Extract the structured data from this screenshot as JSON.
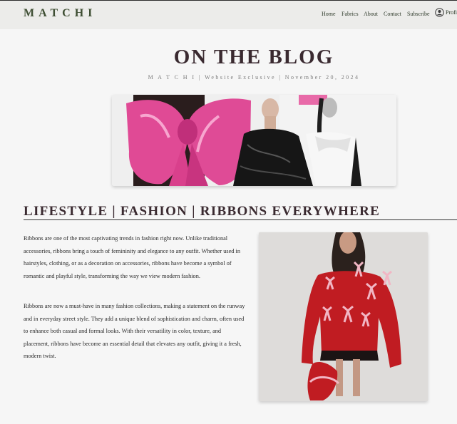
{
  "header": {
    "logo": "MATCHI",
    "nav": [
      "Home",
      "Fabrics",
      "About",
      "Contact",
      "Subscribe"
    ],
    "profile_label": "Profile"
  },
  "blog": {
    "title": "ON THE BLOG",
    "meta": "M A T C H I | Website Exclusive | November 20, 2024"
  },
  "article": {
    "heading": "LIFESTYLE | FASHION | RIBBONS EVERYWHERE",
    "paragraphs": [
      "Ribbons are one of the most captivating trends in fashion right now. Unlike traditional accessories, ribbons bring a touch of femininity and elegance to any outfit. Whether used in hairstyles, clothing, or as a decoration on accessories, ribbons have become a symbol of romantic and playful style, transforming the way we view modern fashion.",
      "Ribbons are now a must-have in many fashion collections, making a statement on the runway and in everyday street style. They add a unique blend of sophistication and charm, often used to enhance both casual and formal looks. With their versatility in color, texture, and placement, ribbons have become an essential detail that elevates any outfit, giving it a fresh, modern twist."
    ]
  },
  "colors": {
    "logo": "#3f4f34",
    "pink_bow": "#e0509a",
    "red_sweater": "#c01c22",
    "background": "#f6f6f6"
  }
}
